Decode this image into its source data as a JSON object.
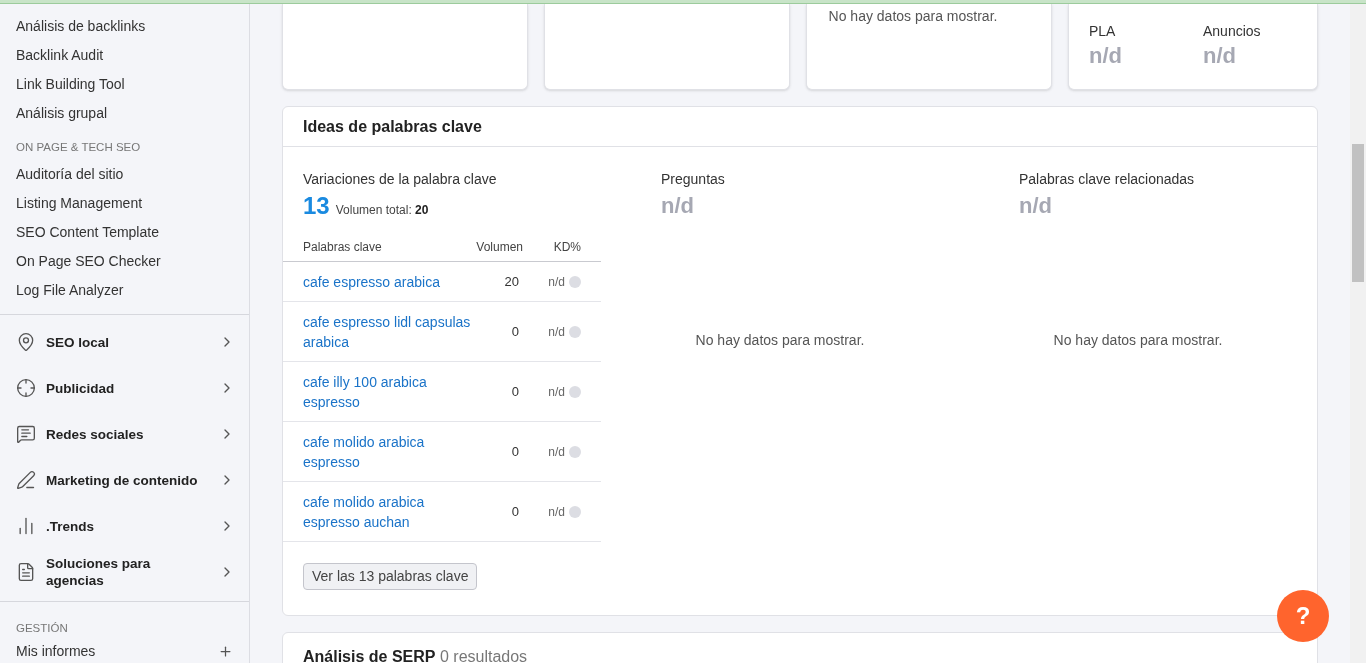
{
  "sidebar": {
    "links": [
      {
        "label": "Análisis de backlinks"
      },
      {
        "label": "Backlink Audit"
      },
      {
        "label": "Link Building Tool"
      },
      {
        "label": "Análisis grupal"
      }
    ],
    "section": {
      "title": "ON PAGE & TECH SEO",
      "links": [
        {
          "label": "Auditoría del sitio"
        },
        {
          "label": "Listing Management"
        },
        {
          "label": "SEO Content Template"
        },
        {
          "label": "On Page SEO Checker"
        },
        {
          "label": "Log File Analyzer"
        }
      ]
    },
    "groups": [
      {
        "label": "SEO local"
      },
      {
        "label": "Publicidad"
      },
      {
        "label": "Redes sociales"
      },
      {
        "label": "Marketing de contenido"
      },
      {
        "label": ".Trends"
      },
      {
        "label": "Soluciones para agencias"
      }
    ],
    "management": {
      "title": "GESTIÓN",
      "links": [
        {
          "label": "Mis informes"
        }
      ]
    }
  },
  "top_cards": [
    {
      "kind": "blank"
    },
    {
      "kind": "blank"
    },
    {
      "kind": "message",
      "message": "No hay datos para mostrar."
    },
    {
      "kind": "metrics",
      "metrics": [
        {
          "label": "PLA",
          "value": "n/d"
        },
        {
          "label": "Anuncios",
          "value": "n/d"
        }
      ]
    }
  ],
  "keyword_ideas": {
    "title": "Ideas de palabras clave",
    "variations": {
      "title": "Variaciones de la palabra clave",
      "count": "13",
      "total_label": "Volumen total:",
      "total": "20",
      "columns": [
        "Palabras clave",
        "Volumen",
        "KD%"
      ],
      "rows": [
        {
          "keyword": "cafe espresso arabica",
          "volume": "20",
          "kd": "n/d"
        },
        {
          "keyword": "cafe espresso lidl capsulas arabica",
          "volume": "0",
          "kd": "n/d"
        },
        {
          "keyword": "cafe illy 100 arabica espresso",
          "volume": "0",
          "kd": "n/d"
        },
        {
          "keyword": "cafe molido arabica espresso",
          "volume": "0",
          "kd": "n/d"
        },
        {
          "keyword": "cafe molido arabica espresso auchan",
          "volume": "0",
          "kd": "n/d"
        }
      ],
      "button": "Ver las 13 palabras clave"
    },
    "questions": {
      "title": "Preguntas",
      "value": "n/d",
      "message": "No hay datos para mostrar."
    },
    "related": {
      "title": "Palabras clave relacionadas",
      "value": "n/d",
      "message": "No hay datos para mostrar."
    }
  },
  "serp": {
    "title": "Análisis de SERP",
    "count": "0 resultados"
  },
  "help_button": "?"
}
